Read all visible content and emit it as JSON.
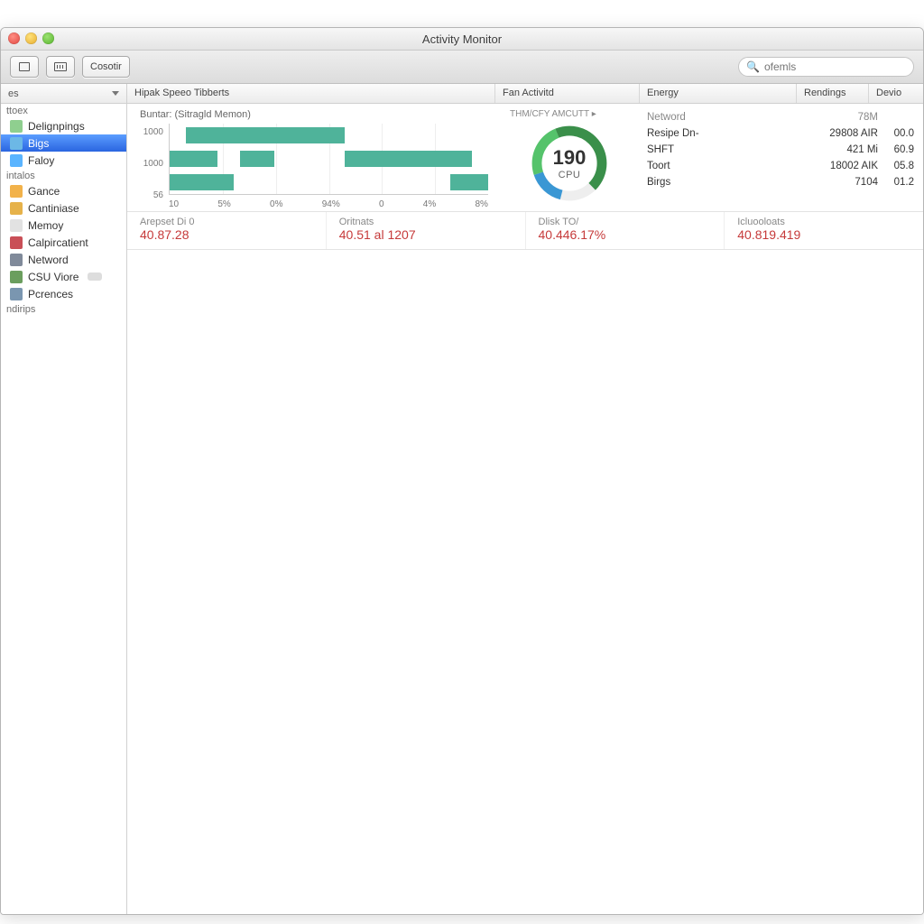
{
  "window": {
    "title": "Activity Monitor"
  },
  "toolbar": {
    "popLabel": "Cosotir",
    "search_placeholder": "ofemls"
  },
  "sidebar": {
    "popup": "es",
    "sec1": "ttoex",
    "items1": [
      {
        "label": "Delignpings",
        "icon": "#8fcf8f"
      },
      {
        "label": "Bigs",
        "icon": "#6cb8e6",
        "selected": true
      },
      {
        "label": "Faloy",
        "icon": "#5ab4ff"
      }
    ],
    "sec2": "intalos",
    "items2": [
      {
        "label": "Gance",
        "icon": "#f2b24a"
      },
      {
        "label": "Cantiniase",
        "icon": "#e6b24a"
      },
      {
        "label": "Memoy",
        "icon": "#e2e2e2"
      },
      {
        "label": "Calpircatient",
        "icon": "#c94f57"
      },
      {
        "label": "Netword",
        "icon": "#808a9a"
      },
      {
        "label": "CSU Viore",
        "icon": "#6b9e5e",
        "badge": true
      },
      {
        "label": "Pcrences",
        "icon": "#7a96b0"
      }
    ],
    "sec3": "ndirips"
  },
  "headers": {
    "col1": "Hipak Speeo Tibberts",
    "col2": "Fan Activitd",
    "col3": "Energy",
    "col4": "Rendings",
    "col5": "Devio"
  },
  "barpanel": {
    "subtitle": "Buntar: (Sitragld Memon)"
  },
  "gauge": {
    "value": "190",
    "label": "CPU"
  },
  "energy": {
    "header": "Netword",
    "rows": [
      {
        "n": "Resipe Dn-",
        "v": "29808 AIR",
        "v2": "00.0"
      },
      {
        "n": "SHFT",
        "v": "421 Mi",
        "v2": "60.9"
      },
      {
        "n": "Toort",
        "v": "18002 AIK",
        "v2": "05.8"
      },
      {
        "n": "Birgs",
        "v": "7104",
        "v2": "01.2"
      }
    ]
  },
  "summary": [
    {
      "label": "Arepset Di 0",
      "value": "40.87.28"
    },
    {
      "label": "Oritnats",
      "value": "40.51 al 1207"
    },
    {
      "label": "Dlisk  TO/",
      "value": "40.446.17%"
    },
    {
      "label": "Icluooloats",
      "value": "40.819.419"
    }
  ],
  "chart_data": {
    "type": "bar",
    "orientation": "horizontal",
    "title": "Buntar: (Sitragld Memon)",
    "series": [
      {
        "name": "row1",
        "segments": [
          {
            "start": 5,
            "end": 55
          }
        ]
      },
      {
        "name": "row2",
        "segments": [
          {
            "start": 0,
            "end": 15
          },
          {
            "start": 22,
            "end": 33
          },
          {
            "start": 55,
            "end": 95
          }
        ]
      },
      {
        "name": "row3",
        "segments": [
          {
            "start": 0,
            "end": 20
          },
          {
            "start": 88,
            "end": 100
          }
        ]
      }
    ],
    "y_ticks": [
      "1000",
      "1000",
      "56"
    ],
    "x_ticks": [
      "10",
      "5%",
      "0%",
      "94%",
      "0",
      "4%",
      "8%"
    ],
    "xlim": [
      0,
      100
    ]
  }
}
